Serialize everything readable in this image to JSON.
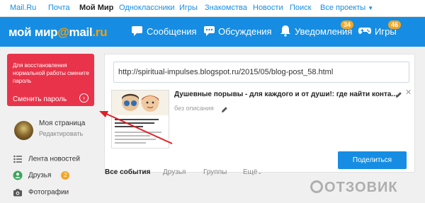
{
  "topnav": {
    "items": [
      "Mail.Ru",
      "Почта",
      "Мой Мир",
      "Одноклассники",
      "Игры",
      "Знакомства",
      "Новости",
      "Поиск",
      "Все проекты"
    ]
  },
  "header": {
    "logo_main": "мой мир",
    "logo_at": "@",
    "logo_mail": "mail",
    "logo_ru": ".ru",
    "messages": "Сообщения",
    "discussions": "Обсуждения",
    "notifications": "Уведомления",
    "notifications_count": "34",
    "games": "Игры",
    "games_count": "46"
  },
  "alert": {
    "text": "Для восстановления нормальной работы смените пароль",
    "link": "Сменить пароль"
  },
  "profile": {
    "name": "Моя страница",
    "edit": "Редактировать"
  },
  "sidebar": {
    "items": [
      {
        "label": "Лента новостей",
        "badge": ""
      },
      {
        "label": "Друзья",
        "badge": "2"
      },
      {
        "label": "Фотографии",
        "badge": ""
      }
    ]
  },
  "share": {
    "url": "http://spiritual-impulses.blogspot.ru/2015/05/blog-post_58.html",
    "title": "Душевные порывы - для каждого и от души!: где найти конта...",
    "description": "без описания",
    "share_label": "Поделиться"
  },
  "tabs": [
    "Все события",
    "Друзья",
    "Группы",
    "Ещё"
  ],
  "watermark": "ОТЗОВИК",
  "colors": {
    "brand_blue": "#168de2",
    "alert_red": "#e8334a",
    "badge_orange": "#f5a623",
    "logo_orange": "#ff9e00"
  }
}
